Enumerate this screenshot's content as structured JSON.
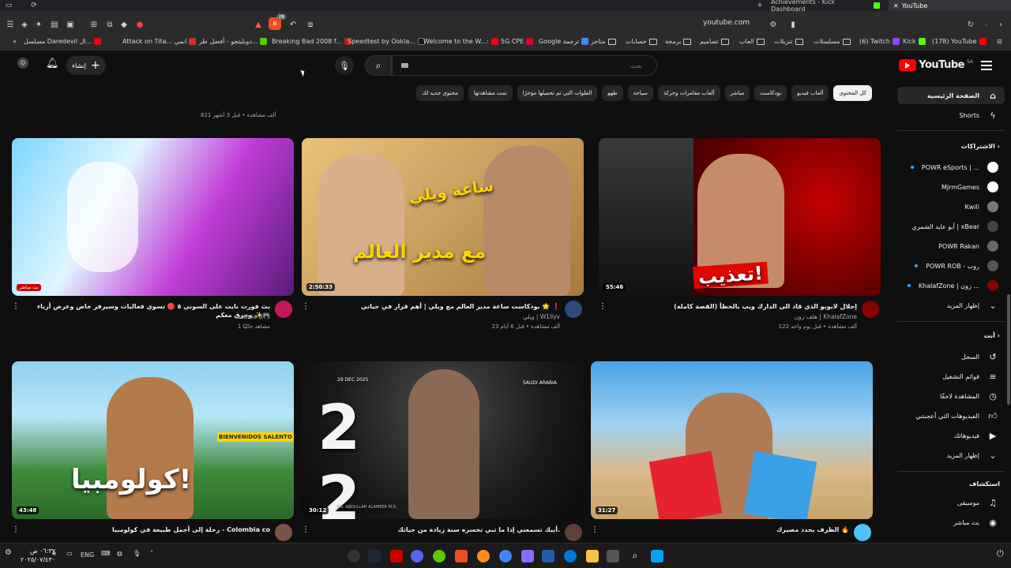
{
  "browser": {
    "tabs": [
      {
        "label": "Achievements - Kick Dashboard",
        "icon": "kick-icon"
      },
      {
        "label": "YouTube",
        "icon": "youtube-icon",
        "active": true
      }
    ],
    "url": "youtube.com",
    "extension_badge": "28",
    "bookmarks": [
      {
        "label": "مسلسل Daredevil ال...",
        "color": "#e50914"
      },
      {
        "label": "Attack on Tita... انمي",
        "color": "#d32f2f"
      },
      {
        "label": "دوبليتجو - أفضل طر...",
        "color": "#58cc02"
      },
      {
        "label": "Breaking Bad 2008 f...",
        "color": "#b71c1c"
      },
      {
        "label": "Speedtest by Ookla...",
        "color": "#141526"
      },
      {
        "label": "Welcome to the W...:",
        "color": "#e50914"
      },
      {
        "label": "5G CPE",
        "color": "#cf0a2c"
      },
      {
        "label": "Google ترجمة",
        "color": "#4285f4"
      },
      {
        "label": "متاجر",
        "color": "folder"
      },
      {
        "label": "حسابات",
        "color": "folder"
      },
      {
        "label": "برمجة",
        "color": "folder"
      },
      {
        "label": "تصاميم",
        "color": "folder"
      },
      {
        "label": "العاب",
        "color": "folder"
      },
      {
        "label": "تنزيلات",
        "color": "folder"
      },
      {
        "label": "مسلسلات",
        "color": "folder"
      },
      {
        "label": "(6) Twitch",
        "color": "#9146ff"
      },
      {
        "label": "Kick",
        "color": "#53fc18"
      },
      {
        "label": "(178) YouTube",
        "color": "#ff0000"
      }
    ]
  },
  "youtube": {
    "logo_text": "YouTube",
    "region": "SA",
    "search_placeholder": "بحث",
    "create_label": "إنشاء",
    "chips": [
      "كل المحتوى",
      "ألعاب فيديو",
      "بودكاست",
      "مباشر",
      "ألعاب مغامرات وحركة",
      "سياحة",
      "طهو",
      "الفلوات التي تم تحميلها مؤخرًا",
      "تمت مشاهدتها",
      "محتوى جديد لك"
    ],
    "prev_row_meta": "821 ألف مشاهدة • قبل 3 أشهر",
    "sidebar": {
      "home": "الصفحة الرئيسية",
      "shorts": "Shorts",
      "subscriptions_title": "الاشتراكات",
      "subscriptions": [
        {
          "name": "POWR eSports | ...",
          "color": "#ffffff",
          "live": true
        },
        {
          "name": "MjrmGames",
          "color": "#ffffff",
          "live": false
        },
        {
          "name": "Kwili",
          "color": "#777777",
          "live": false
        },
        {
          "name": "أبو عابد الشمري | xBear",
          "color": "#444444",
          "live": false
        },
        {
          "name": "POWR Rakan",
          "color": "#666666",
          "live": false
        },
        {
          "name": "POWR ROB - روب",
          "color": "#555555",
          "live": true
        },
        {
          "name": "KhalafZone | زون ...",
          "color": "#8b0000",
          "live": true
        }
      ],
      "show_more": "إظهار المزيد",
      "you_title": "أنت",
      "you_items": [
        {
          "label": "السجل",
          "icon": "history-icon"
        },
        {
          "label": "قوائم التشغيل",
          "icon": "playlist-icon"
        },
        {
          "label": "المشاهدة لاحقًا",
          "icon": "watch-later-icon"
        },
        {
          "label": "الفيديوهات التي أعجبتني",
          "icon": "like-icon"
        },
        {
          "label": "فيديوهاتك",
          "icon": "your-videos-icon"
        }
      ],
      "show_more_2": "إظهار المزيد",
      "explore_title": "استكشاف",
      "explore_items": [
        {
          "label": "موسيقى",
          "icon": "music-icon"
        },
        {
          "label": "بث مباشر",
          "icon": "live-icon"
        }
      ]
    },
    "videos": [
      {
        "title": "إحلال لابوبو الذي قاد الى الدارك ويب بالخطأ (القصة كاملة)",
        "channel": "هلف زون | KhalafZone",
        "meta_views": "122 ألف مشاهدة",
        "meta_time": "قبل يوم واحد",
        "duration": "55:46",
        "thumb_text": "تعذيب!",
        "avatar_color": "#8b0000"
      },
      {
        "title": "بودكاست ساعة مدير العالم مع ويلي | أهم قرار في حياتي 🌟 ❗",
        "channel": "ويلي | W1llyv",
        "meta_views": "23 ألف مشاهدة",
        "meta_time": "قبل 6 أيام",
        "duration": "2:50:33",
        "thumb_text": "مع مدير العالم",
        "thumb_text2": "ساعة ويلي",
        "avatar_color": "#2b4a7a"
      },
      {
        "title": "بث فورت نايت على السوني ٥ 🔴 تسوي فعاليات وسيرفر خاص وعرض أزياء وحرق معكم ✨🎮",
        "channel": "osama-375",
        "meta_views": "1 مشاهد حاليًا",
        "meta_time": "",
        "duration": "",
        "live_badge": "بث مباشر",
        "thumb_text": "",
        "avatar_color": "#c2185b"
      },
      {
        "title": "الظرف يحدد مصيرك 🔥",
        "channel": "",
        "meta_views": "",
        "meta_time": "",
        "duration": "31:27",
        "thumb_text": "",
        "avatar_color": "#4fc3f7"
      },
      {
        "title": "أبيك تسمعني إذا ما تبي تخسره سنة زيادة من حياتك.",
        "channel": "",
        "meta_views": "",
        "meta_time": "",
        "duration": "30:12",
        "thumb_text": "20  26",
        "thumb_small": "29 DEC 2025",
        "thumb_small2": "SAUDI ARABIA",
        "thumb_sign": "DR. ABDULLAH ALAMEER M.D.",
        "avatar_color": "#5d4037"
      },
      {
        "title": "رحلة إلى أجمل طبيعة في كولومبيا - Colombia co",
        "channel": "",
        "meta_views": "",
        "meta_time": "",
        "duration": "43:48",
        "thumb_text": "كولومبيا!",
        "thumb_sign": "BIENVENIDOS SALENTO",
        "avatar_color": "#795548"
      }
    ]
  },
  "taskbar": {
    "time": "٠٦:٣٧ ص",
    "date": "٢٠٢٥/٠٧/٤٣٠",
    "lang": "ENG"
  },
  "colors": {
    "accent": "#ff0000",
    "bg": "#0f0f0f",
    "chip_bg": "#272727"
  }
}
